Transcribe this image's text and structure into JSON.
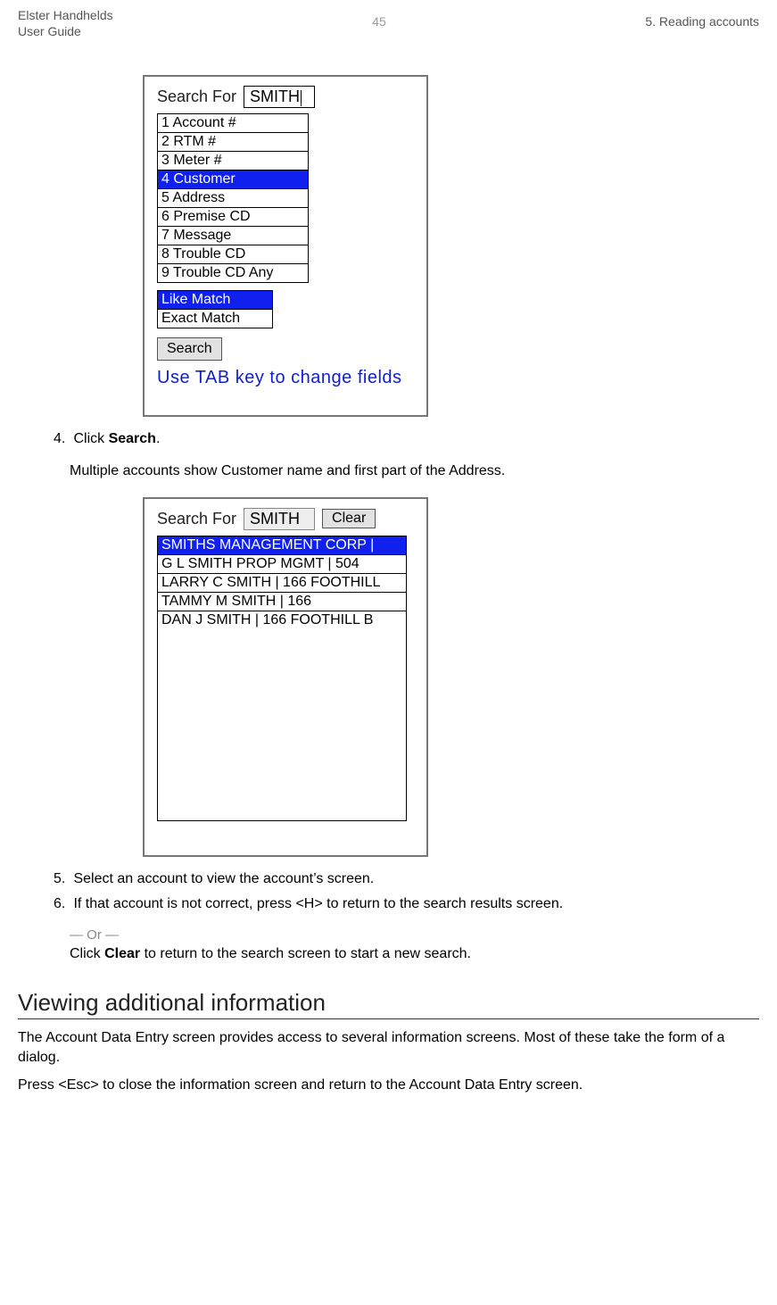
{
  "header": {
    "product_line1": "Elster Handhelds",
    "product_line2": "User Guide",
    "page_number": "45",
    "chapter": "5. Reading accounts"
  },
  "screen1": {
    "search_label": "Search For",
    "search_value": "SMITH",
    "options": [
      {
        "label": "1 Account #",
        "selected": false
      },
      {
        "label": "2 RTM #",
        "selected": false
      },
      {
        "label": "3 Meter #",
        "selected": false
      },
      {
        "label": "4 Customer",
        "selected": true
      },
      {
        "label": "5 Address",
        "selected": false
      },
      {
        "label": "6 Premise CD",
        "selected": false
      },
      {
        "label": "7 Message",
        "selected": false
      },
      {
        "label": "8 Trouble CD",
        "selected": false
      },
      {
        "label": "9 Trouble CD Any",
        "selected": false
      }
    ],
    "match_modes": [
      {
        "label": "Like Match",
        "selected": true
      },
      {
        "label": "Exact Match",
        "selected": false
      }
    ],
    "search_button": "Search",
    "hint": "Use TAB key to change fields"
  },
  "step4": {
    "num": "4.",
    "text_prefix": "Click ",
    "bold": "Search",
    "text_suffix": ".",
    "followup": "Multiple accounts show Customer name and first part of the Address."
  },
  "screen2": {
    "search_label": "Search For",
    "search_value": "SMITH",
    "clear_button": "Clear",
    "results": [
      {
        "label": "SMITHS MANAGEMENT CORP |",
        "selected": true
      },
      {
        "label": "G L SMITH PROP MGMT | 504",
        "selected": false
      },
      {
        "label": "LARRY C SMITH |  166 FOOTHILL",
        "selected": false
      },
      {
        "label": "TAMMY M SMITH |  166",
        "selected": false
      },
      {
        "label": "DAN J SMITH |  166 FOOTHILL B",
        "selected": false
      }
    ]
  },
  "step5": {
    "num": "5.",
    "text": "Select an account to view the account’s screen."
  },
  "step6": {
    "num": "6.",
    "text": "If that account is not correct, press <H> to return to the search results screen.",
    "or": "— Or —",
    "after_prefix": "Click ",
    "after_bold": "Clear",
    "after_suffix": " to return to the search screen to start a new search."
  },
  "section": {
    "heading": "Viewing additional information",
    "p1": "The Account Data Entry screen provides access to several information screens. Most of these take the form of a dialog.",
    "p2": "Press <Esc> to close the information screen and return to the Account Data Entry screen."
  }
}
